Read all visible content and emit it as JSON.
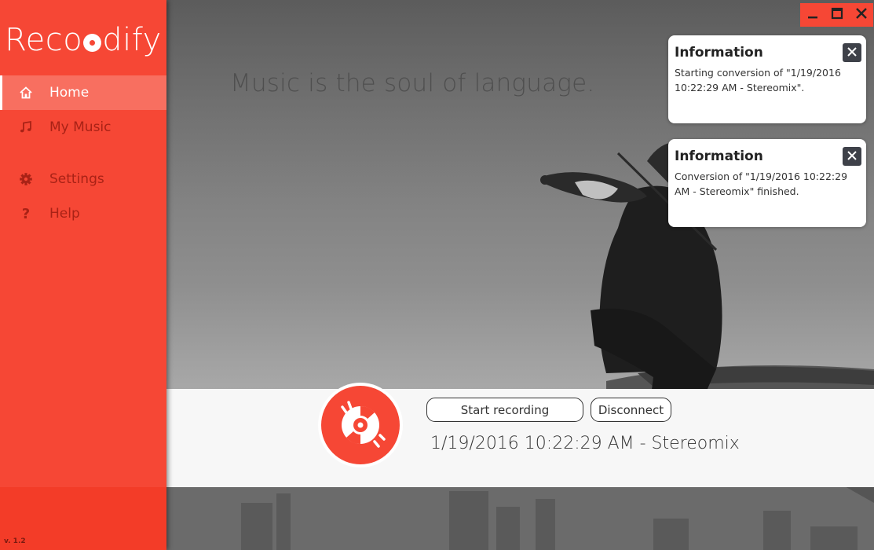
{
  "app": {
    "logo_prefix": "Reco",
    "logo_suffix": "dify",
    "version": "v. 1.2"
  },
  "sidebar": {
    "items": [
      {
        "label": "Home",
        "icon": "home-icon",
        "active": true
      },
      {
        "label": "My Music",
        "icon": "music-note-icon",
        "active": false
      },
      {
        "label": "Settings",
        "icon": "gear-icon",
        "active": false
      },
      {
        "label": "Help",
        "icon": "question-icon",
        "active": false
      }
    ]
  },
  "main": {
    "quote": "Music is the soul of language."
  },
  "window_controls": {
    "icons": [
      "minimize-icon",
      "maximize-icon",
      "close-icon"
    ]
  },
  "notifications": [
    {
      "title": "Information",
      "message": "Starting conversion of \"1/19/2016 10:22:29 AM - Stereomix\"."
    },
    {
      "title": "Information",
      "message": "Conversion of \"1/19/2016 10:22:29 AM - Stereomix\" finished."
    }
  ],
  "controls": {
    "start_label": "Start recording",
    "disconnect_label": "Disconnect",
    "device": "1/19/2016 10:22:29 AM - Stereomix",
    "record_icon": "record-disc-icon"
  },
  "colors": {
    "accent": "#f64735",
    "accent_dark": "#f33c28",
    "nav_active": "#f86f60",
    "nav_text": "#a92216",
    "toast_close_bg": "#3e4149"
  }
}
